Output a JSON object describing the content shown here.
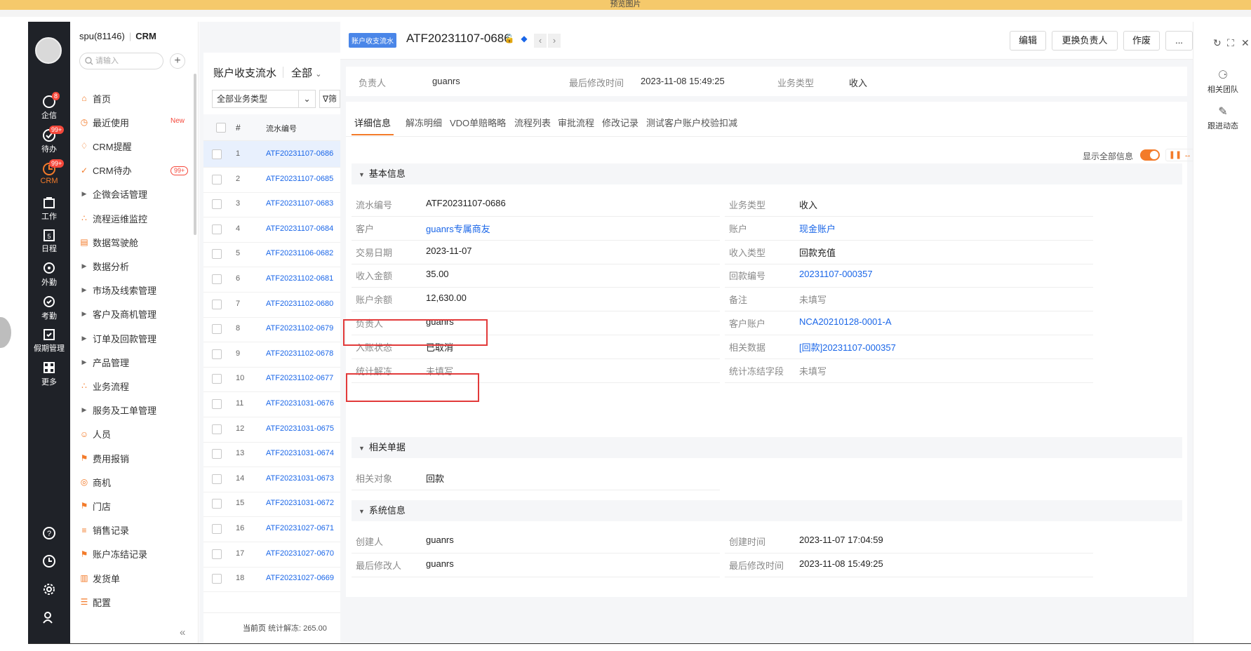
{
  "banner": {
    "text": "预览图片"
  },
  "rail": {
    "items": [
      {
        "label": "企信",
        "badge": "8"
      },
      {
        "label": "待办",
        "badge": "99+"
      },
      {
        "label": "CRM",
        "badge": "99+"
      },
      {
        "label": "工作"
      },
      {
        "label": "日程",
        "glyph": "5"
      },
      {
        "label": "外勤"
      },
      {
        "label": "考勤"
      },
      {
        "label": "假期管理"
      },
      {
        "label": "更多"
      }
    ]
  },
  "menu": {
    "account": "spu(81146)",
    "app": "CRM",
    "search_placeholder": "请输入",
    "add": "+",
    "items": [
      {
        "label": "首页",
        "icon": "home-icon"
      },
      {
        "label": "最近使用",
        "icon": "clock-icon",
        "tag": "New"
      },
      {
        "label": "CRM提醒",
        "icon": "bell-icon"
      },
      {
        "label": "CRM待办",
        "icon": "check-circle-icon",
        "badge": "99+"
      },
      {
        "label": "企微会话管理",
        "icon": "caret-right-icon"
      },
      {
        "label": "流程运维监控",
        "icon": "org-icon"
      },
      {
        "label": "数据驾驶舱",
        "icon": "dashboard-icon"
      },
      {
        "label": "数据分析",
        "icon": "caret-right-icon"
      },
      {
        "label": "市场及线索管理",
        "icon": "caret-right-icon"
      },
      {
        "label": "客户及商机管理",
        "icon": "caret-right-icon"
      },
      {
        "label": "订单及回款管理",
        "icon": "caret-right-icon"
      },
      {
        "label": "产品管理",
        "icon": "caret-right-icon"
      },
      {
        "label": "业务流程",
        "icon": "org-icon"
      },
      {
        "label": "服务及工单管理",
        "icon": "caret-right-icon"
      },
      {
        "label": "人员",
        "icon": "people-icon"
      },
      {
        "label": "费用报销",
        "icon": "flag-icon"
      },
      {
        "label": "商机",
        "icon": "target-icon"
      },
      {
        "label": "门店",
        "icon": "flag-icon"
      },
      {
        "label": "销售记录",
        "icon": "chart-icon"
      },
      {
        "label": "账户冻结记录",
        "icon": "flag-icon"
      },
      {
        "label": "发货单",
        "icon": "doc-icon"
      },
      {
        "label": "配置",
        "icon": "sliders-icon"
      }
    ],
    "collapse": "«"
  },
  "list": {
    "title": "账户收支流水",
    "scope": "全部",
    "filter_select": "全部业务类型",
    "filter_btn": "筛",
    "col_index": "#",
    "col_code": "流水编号",
    "rows": [
      {
        "n": "1",
        "code": "ATF20231107-0686"
      },
      {
        "n": "2",
        "code": "ATF20231107-0685"
      },
      {
        "n": "3",
        "code": "ATF20231107-0683"
      },
      {
        "n": "4",
        "code": "ATF20231107-0684"
      },
      {
        "n": "5",
        "code": "ATF20231106-0682"
      },
      {
        "n": "6",
        "code": "ATF20231102-0681"
      },
      {
        "n": "7",
        "code": "ATF20231102-0680"
      },
      {
        "n": "8",
        "code": "ATF20231102-0679"
      },
      {
        "n": "9",
        "code": "ATF20231102-0678"
      },
      {
        "n": "10",
        "code": "ATF20231102-0677"
      },
      {
        "n": "11",
        "code": "ATF20231031-0676"
      },
      {
        "n": "12",
        "code": "ATF20231031-0675"
      },
      {
        "n": "13",
        "code": "ATF20231031-0674"
      },
      {
        "n": "14",
        "code": "ATF20231031-0673"
      },
      {
        "n": "15",
        "code": "ATF20231031-0672"
      },
      {
        "n": "16",
        "code": "ATF20231027-0671"
      },
      {
        "n": "17",
        "code": "ATF20231027-0670"
      },
      {
        "n": "18",
        "code": "ATF20231027-0669"
      }
    ],
    "footer_page": "当前页",
    "footer_stat": "统计解冻: 265.00"
  },
  "detail": {
    "tag": "账户收支流水",
    "title": "ATF20231107-0686",
    "buttons": {
      "edit": "编辑",
      "change_owner": "更换负责人",
      "void": "作废",
      "more": "..."
    },
    "info": {
      "owner_label": "负责人",
      "owner": "guanrs",
      "modified_label": "最后修改时间",
      "modified": "2023-11-08 15:49:25",
      "type_label": "业务类型",
      "type": "收入"
    },
    "tabs": [
      "详细信息",
      "解冻明细",
      "VDO单赔略略",
      "流程列表",
      "审批流程",
      "修改记录",
      "测试客户账户校验扣减"
    ],
    "show_all": "显示全部信息",
    "sections": {
      "basic": "基本信息",
      "related": "相关单据",
      "system": "系统信息"
    },
    "basic_left": [
      {
        "label": "流水编号",
        "value": "ATF20231107-0686"
      },
      {
        "label": "客户",
        "value": "guanrs专属商友",
        "link": true
      },
      {
        "label": "交易日期",
        "value": "2023-11-07"
      },
      {
        "label": "收入金额",
        "value": "35.00"
      },
      {
        "label": "账户余额",
        "value": "12,630.00"
      },
      {
        "label": "负责人",
        "value": "guanrs"
      },
      {
        "label": "入账状态",
        "value": "已取消"
      },
      {
        "label": "统计解冻",
        "value": "未填写",
        "empty": true
      }
    ],
    "basic_right": [
      {
        "label": "业务类型",
        "value": "收入"
      },
      {
        "label": "账户",
        "value": "现金账户",
        "link": true
      },
      {
        "label": "收入类型",
        "value": "回款充值"
      },
      {
        "label": "回款编号",
        "value": "20231107-000357",
        "link": true
      },
      {
        "label": "备注",
        "value": "未填写",
        "empty": true
      },
      {
        "label": "客户账户",
        "value": "NCA20210128-0001-A",
        "link": true
      },
      {
        "label": "相关数据",
        "value": "[回款]20231107-000357",
        "link": true
      },
      {
        "label": "统计冻结字段",
        "value": "未填写",
        "empty": true
      }
    ],
    "related": {
      "label": "相关对象",
      "value": "回款"
    },
    "system_left": [
      {
        "label": "创建人",
        "value": "guanrs"
      },
      {
        "label": "最后修改人",
        "value": "guanrs"
      }
    ],
    "system_right": [
      {
        "label": "创建时间",
        "value": "2023-11-07 17:04:59"
      },
      {
        "label": "最后修改时间",
        "value": "2023-11-08 15:49:25"
      }
    ]
  },
  "right_rail": {
    "team": "相关团队",
    "follow": "跟进动态"
  },
  "colors": {
    "accent": "#f37b2a",
    "link": "#1a66e8",
    "highlight": "#e23a3a",
    "rail": "#1f2228"
  }
}
